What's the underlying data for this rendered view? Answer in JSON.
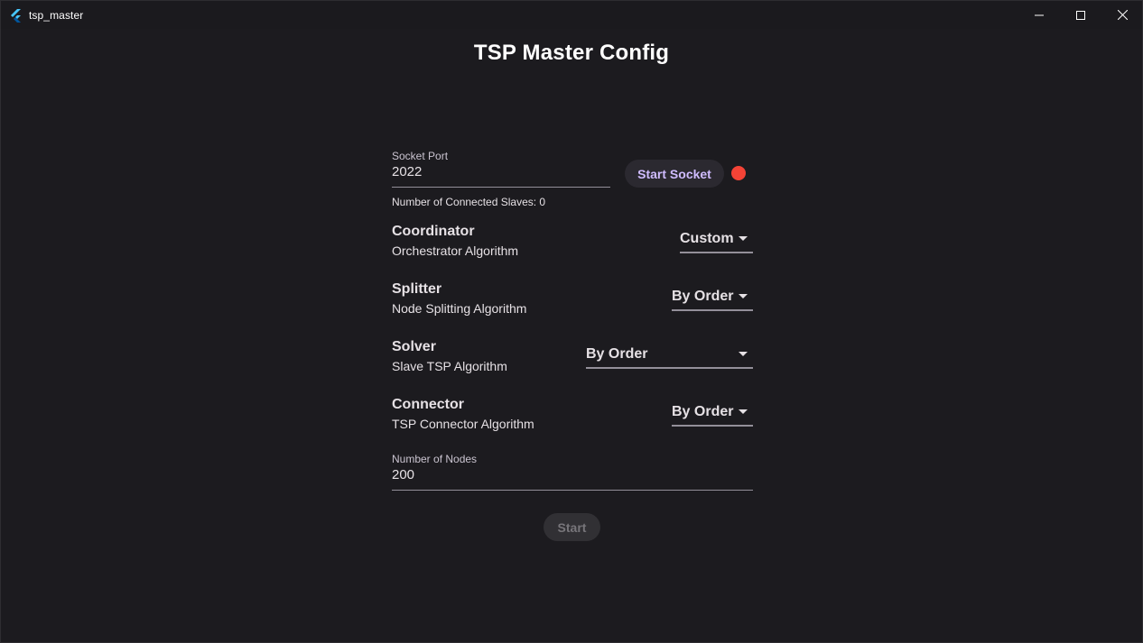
{
  "window": {
    "title": "tsp_master",
    "controls": {
      "minimize": "minimize-icon",
      "maximize": "maximize-icon",
      "close": "close-icon"
    }
  },
  "page": {
    "title": "TSP Master Config"
  },
  "socket": {
    "port_label": "Socket Port",
    "port_value": "2022",
    "start_button": "Start Socket",
    "status_color": "#f44336",
    "connected_text": "Number of Connected Slaves: 0"
  },
  "settings": [
    {
      "title": "Coordinator",
      "subtitle": "Orchestrator Algorithm",
      "selected": "Custom"
    },
    {
      "title": "Splitter",
      "subtitle": "Node Splitting Algorithm",
      "selected": "By Order"
    },
    {
      "title": "Solver",
      "subtitle": "Slave TSP Algorithm",
      "selected": "By Order"
    },
    {
      "title": "Connector",
      "subtitle": "TSP Connector Algorithm",
      "selected": "By Order"
    }
  ],
  "nodes": {
    "label": "Number of Nodes",
    "value": "200"
  },
  "actions": {
    "start": "Start"
  },
  "colors": {
    "background": "#1c1b1f",
    "accent": "#d0bcff",
    "status_off": "#f44336"
  }
}
